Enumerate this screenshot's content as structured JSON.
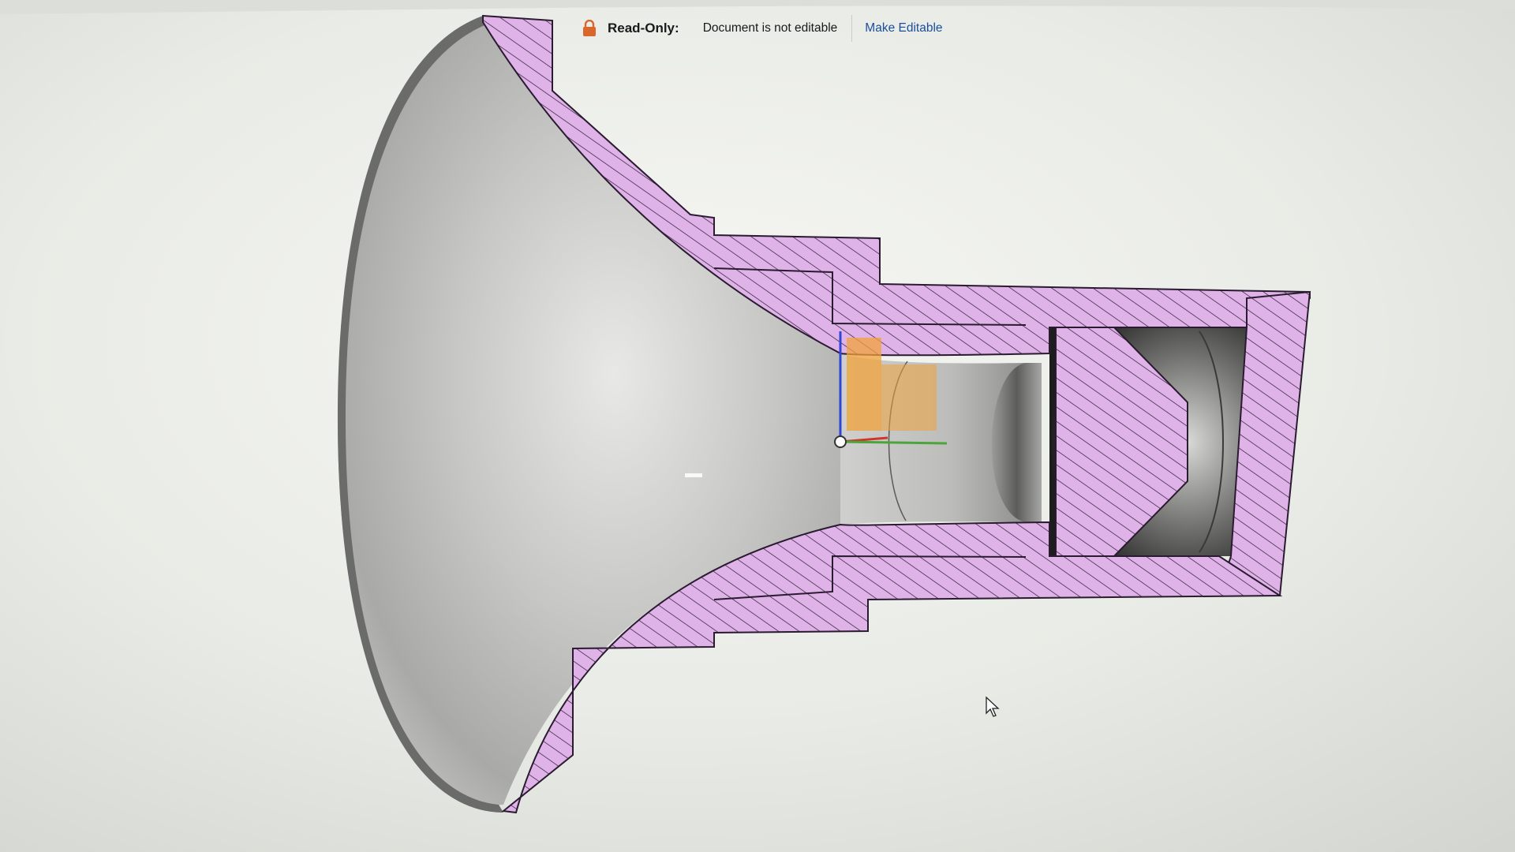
{
  "banner": {
    "icon": "lock-icon",
    "label": "Read-Only:",
    "message": "Document is not editable",
    "action_label": "Make Editable"
  },
  "colors": {
    "section_fill": "#dfb2e8",
    "hatch": "#2a1b30",
    "interior_surface": "#bdbdbb",
    "axis_x": "#d0362c",
    "axis_y": "#4aa63a",
    "axis_z": "#2f47d8",
    "origin_highlight": "#f1a23a",
    "link": "#1a4e9c"
  },
  "viewport": {
    "view": "section-view",
    "cursor_icon": "pointer-arrow-icon",
    "triad_icon": "origin-triad-icon"
  }
}
